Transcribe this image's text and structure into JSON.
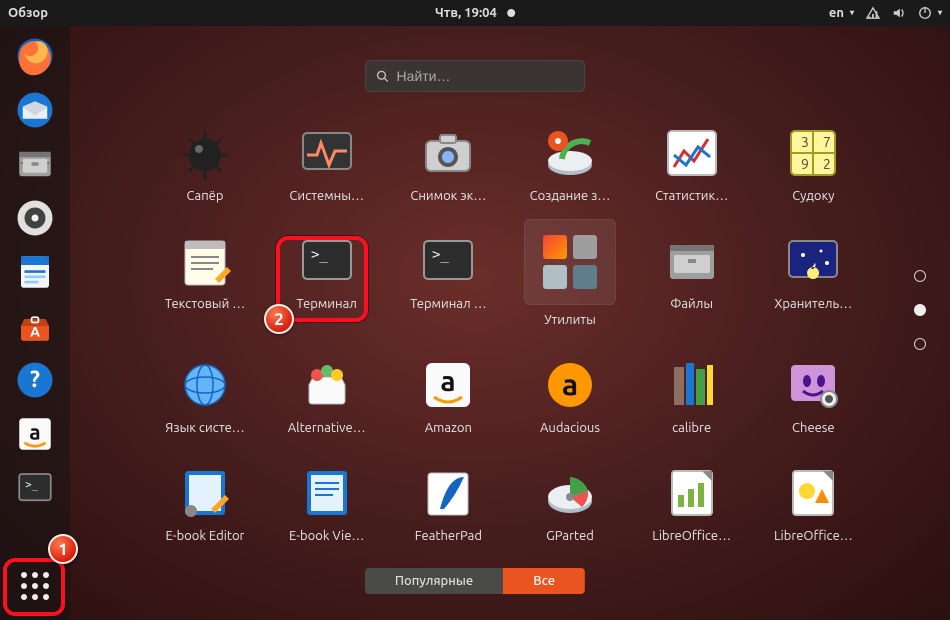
{
  "topbar": {
    "activities": "Обзор",
    "clock": "Чтв, 19:04",
    "input": "en"
  },
  "search": {
    "placeholder": "Найти…"
  },
  "tabs": {
    "frequent": "Популярные",
    "all": "Все",
    "active": "all"
  },
  "dock": [
    "firefox",
    "thunderbird",
    "files",
    "rhythmbox",
    "writer",
    "software",
    "help",
    "amazon",
    "terminal"
  ],
  "apps": {
    "row1": [
      {
        "id": "mines",
        "label": "Сапёр"
      },
      {
        "id": "sysmon",
        "label": "Системны…"
      },
      {
        "id": "screenshot",
        "label": "Снимок эк…"
      },
      {
        "id": "startup",
        "label": "Создание з…"
      },
      {
        "id": "statistics",
        "label": "Статистик…"
      },
      {
        "id": "sudoku",
        "label": "Судоку"
      }
    ],
    "row2": [
      {
        "id": "texteditor",
        "label": "Текстовый …"
      },
      {
        "id": "terminal",
        "label": "Терминал"
      },
      {
        "id": "terminal2",
        "label": "Терминал …"
      },
      {
        "id": "utilities",
        "label": "Утилиты",
        "folder": true
      },
      {
        "id": "files",
        "label": "Файлы"
      },
      {
        "id": "screensaver",
        "label": "Хранитель…"
      }
    ],
    "row3": [
      {
        "id": "language",
        "label": "Язык систе…"
      },
      {
        "id": "altsoft",
        "label": "Alternative…"
      },
      {
        "id": "amazon",
        "label": "Amazon"
      },
      {
        "id": "audacious",
        "label": "Audacious"
      },
      {
        "id": "calibre",
        "label": "calibre"
      },
      {
        "id": "cheese",
        "label": "Cheese"
      }
    ],
    "row4": [
      {
        "id": "ebookedit",
        "label": "E-book Editor"
      },
      {
        "id": "ebookview",
        "label": "E-book Vie…"
      },
      {
        "id": "featherpad",
        "label": "FeatherPad"
      },
      {
        "id": "gparted",
        "label": "GParted"
      },
      {
        "id": "lo1",
        "label": "LibreOffice…"
      },
      {
        "id": "lo2",
        "label": "LibreOffice…"
      }
    ]
  },
  "annotations": {
    "badge1": "1",
    "badge2": "2"
  }
}
